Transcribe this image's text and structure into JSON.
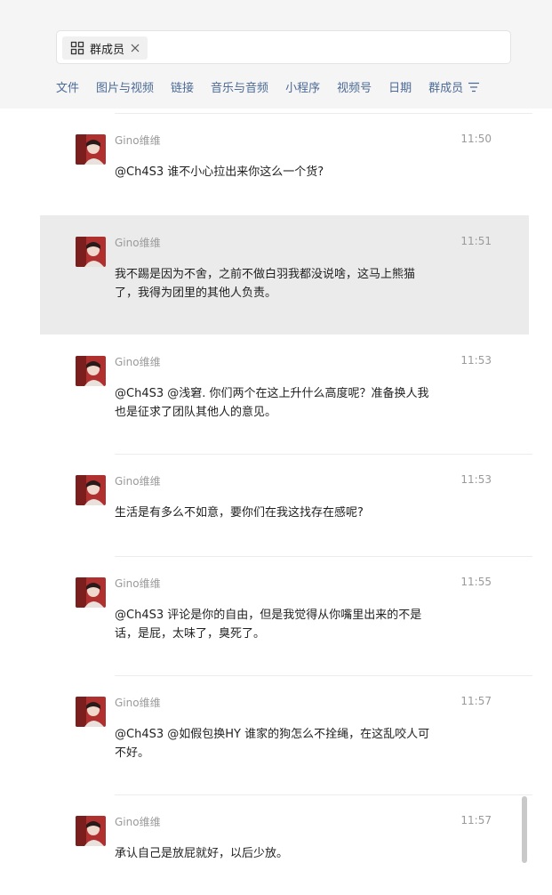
{
  "search": {
    "chip_label": "群成员",
    "chip_icon": "grid-icon",
    "close_icon": "close-icon"
  },
  "tabs": [
    "文件",
    "图片与视频",
    "链接",
    "音乐与音频",
    "小程序",
    "视频号",
    "日期",
    "群成员"
  ],
  "filter_icon": "filter-icon",
  "messages": [
    {
      "sender": "Gino维维",
      "time": "11:50",
      "text": "@Ch4S3 谁不小心拉出来你这么一个货?"
    },
    {
      "sender": "Gino维维",
      "time": "11:51",
      "text": "我不踢是因为不舍，之前不做白羽我都没说啥，这马上熊猫了，我得为团里的其他人负责。"
    },
    {
      "sender": "Gino维维",
      "time": "11:53",
      "text": "@Ch4S3 @浅窘. 你们两个在这上升什么高度呢？准备换人我也是征求了团队其他人的意见。"
    },
    {
      "sender": "Gino维维",
      "time": "11:53",
      "text": "生活是有多么不如意，要你们在我这找存在感呢?"
    },
    {
      "sender": "Gino维维",
      "time": "11:55",
      "text": "@Ch4S3 评论是你的自由，但是我觉得从你嘴里出来的不是话，是屁，太味了，臭死了。"
    },
    {
      "sender": "Gino维维",
      "time": "11:57",
      "text": "@Ch4S3 @如假包换HY 谁家的狗怎么不拴绳，在这乱咬人可不好。"
    },
    {
      "sender": "Gino维维",
      "time": "11:57",
      "text": "承认自己是放屁就好，以后少放。"
    }
  ],
  "highlight_index": 1,
  "colors": {
    "tab": "#4c6a96",
    "highlight": "#ebebeb",
    "topbar": "#f5f5f5"
  }
}
